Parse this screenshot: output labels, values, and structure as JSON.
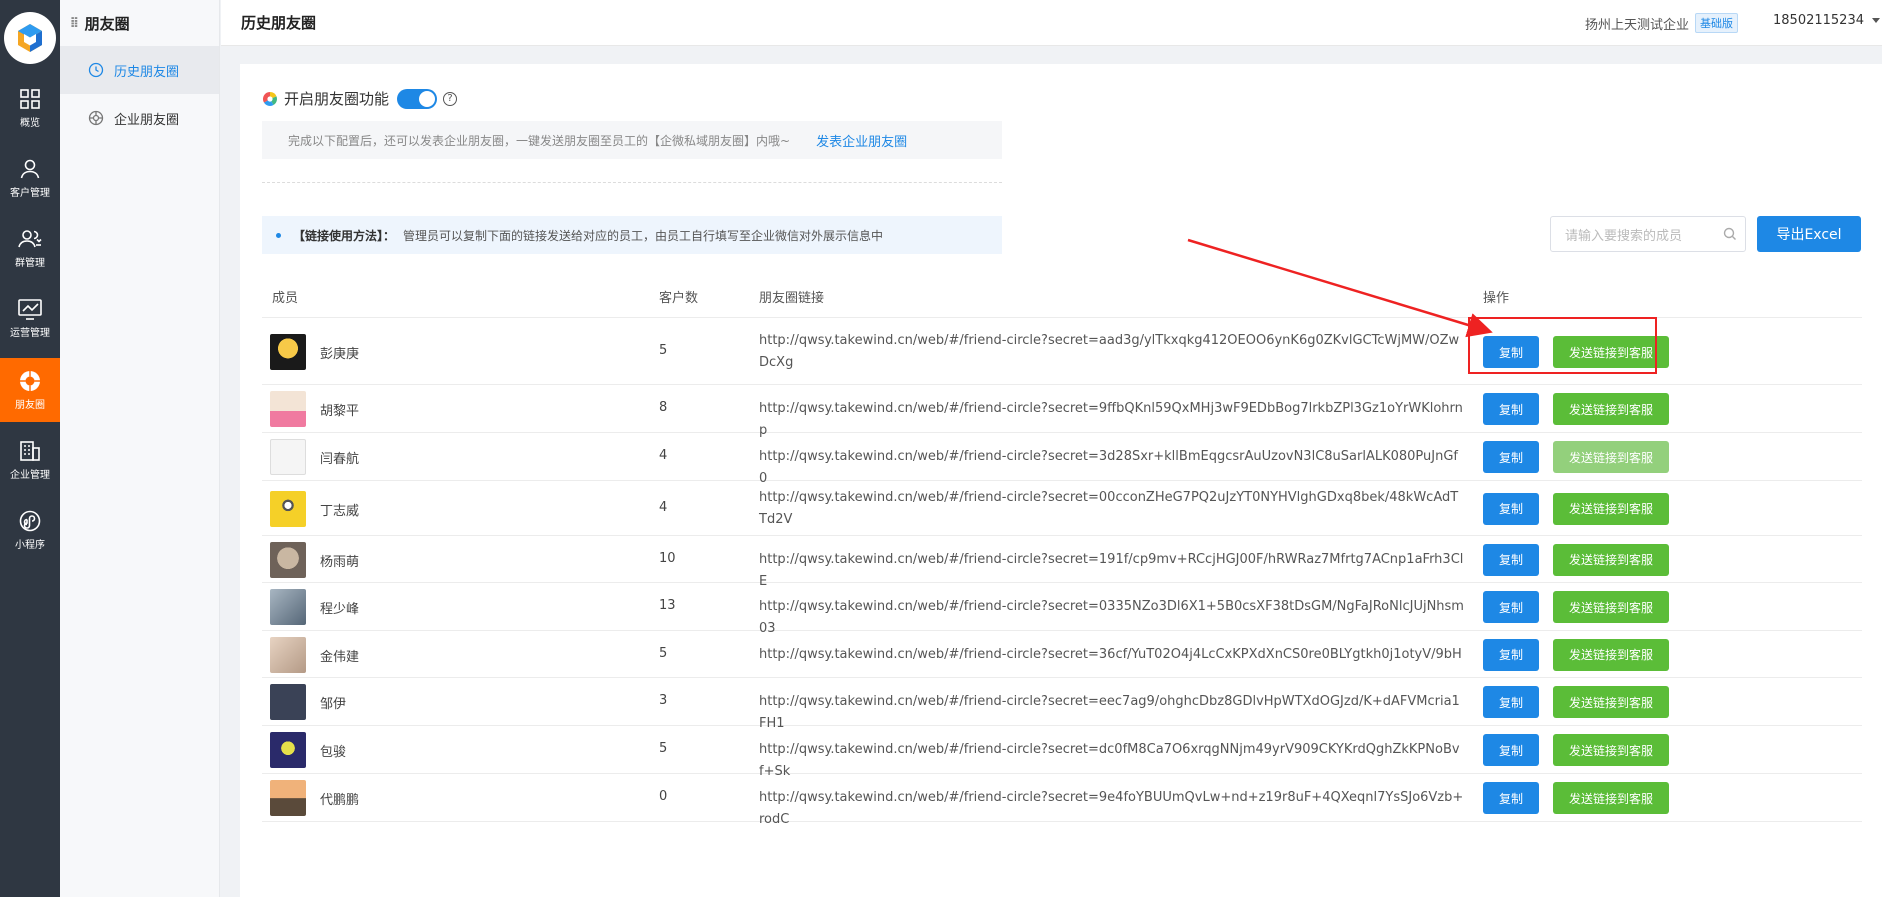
{
  "rail": {
    "items": [
      {
        "label": "概览",
        "icon": "grid-icon"
      },
      {
        "label": "客户管理",
        "icon": "user-icon"
      },
      {
        "label": "群管理",
        "icon": "group-icon"
      },
      {
        "label": "运营管理",
        "icon": "chart-icon"
      },
      {
        "label": "朋友圈",
        "icon": "aperture-icon",
        "active": true
      },
      {
        "label": "企业管理",
        "icon": "building-icon"
      },
      {
        "label": "小程序",
        "icon": "miniprogram-icon"
      }
    ]
  },
  "subnav": {
    "title": "朋友圈",
    "items": [
      {
        "label": "历史朋友圈",
        "active": true
      },
      {
        "label": "企业朋友圈",
        "active": false
      }
    ]
  },
  "header": {
    "title": "历史朋友圈",
    "company": "扬州上天测试企业",
    "badge": "基础版",
    "phone": "18502115234"
  },
  "feature": {
    "label": "开启朋友圈功能",
    "enabled": true,
    "tip": "完成以下配置后，还可以发表企业朋友圈，一键发送朋友圈至员工的【企微私域朋友圈】内哦~",
    "tip_link": "发表企业朋友圈"
  },
  "info": {
    "title": "【链接使用方法】：",
    "text": "管理员可以复制下面的链接发送给对应的员工，由员工自行填写至企业微信对外展示信息中"
  },
  "search": {
    "placeholder": "请输入要搜索的成员"
  },
  "export_label": "导出Excel",
  "table": {
    "columns": [
      "成员",
      "客户数",
      "朋友圈链接",
      "操作"
    ],
    "copy_label": "复制",
    "send_label": "发送链接到客服",
    "rows": [
      {
        "name": "彭庚庚",
        "count": "5",
        "link": "http://qwsy.takewind.cn/web/#/friend-circle?secret=aad3g/ylTkxqkg412OEOO6ynK6g0ZKvlGCTcWjMW/OZwDcXg"
      },
      {
        "name": "胡黎平",
        "count": "8",
        "link": "http://qwsy.takewind.cn/web/#/friend-circle?secret=9ffbQKnl59QxMHj3wF9EDbBog7lrkbZPl3Gz1oYrWKlohrnp"
      },
      {
        "name": "闫春航",
        "count": "4",
        "link": "http://qwsy.takewind.cn/web/#/friend-circle?secret=3d28Sxr+kllBmEqgcsrAuUzovN3lC8uSarlALK080PuJnGf0"
      },
      {
        "name": "丁志威",
        "count": "4",
        "link": "http://qwsy.takewind.cn/web/#/friend-circle?secret=00cconZHeG7PQ2uJzYT0NYHVlghGDxq8bek/48kWcAdTTd2V"
      },
      {
        "name": "杨雨萌",
        "count": "10",
        "link": "http://qwsy.takewind.cn/web/#/friend-circle?secret=191f/cp9mv+RCcjHGJ00F/hRWRaz7Mfrtg7ACnp1aFrh3ClE"
      },
      {
        "name": "程少峰",
        "count": "13",
        "link": "http://qwsy.takewind.cn/web/#/friend-circle?secret=0335NZo3Dl6X1+5B0csXF38tDsGM/NgFaJRoNlcJUjNhsm03"
      },
      {
        "name": "金伟建",
        "count": "5",
        "link": "http://qwsy.takewind.cn/web/#/friend-circle?secret=36cf/YuT02O4j4LcCxKPXdXnCS0re0BLYgtkh0j1otyV/9bH"
      },
      {
        "name": "邹伊",
        "count": "3",
        "link": "http://qwsy.takewind.cn/web/#/friend-circle?secret=eec7ag9/ohghcDbz8GDlvHpWTXdOGJzd/K+dAFVMcria1FH1"
      },
      {
        "name": "包骏",
        "count": "5",
        "link": "http://qwsy.takewind.cn/web/#/friend-circle?secret=dc0fM8Ca7O6xrqgNNjm49yrV909CKYKrdQghZkKPNoBvf+Sk"
      },
      {
        "name": "代鹏鹏",
        "count": "0",
        "link": "http://qwsy.takewind.cn/web/#/friend-circle?secret=9e4foYBUUmQvLw+nd+z19r8uF+4QXeqnl7YsSJo6Vzb+rodC"
      }
    ]
  },
  "colors": {
    "primary": "#1e88e5",
    "success": "#5bbd38",
    "rail": "#2f3742",
    "active_rail": "#ff6a00",
    "annotation": "#ee2222"
  }
}
